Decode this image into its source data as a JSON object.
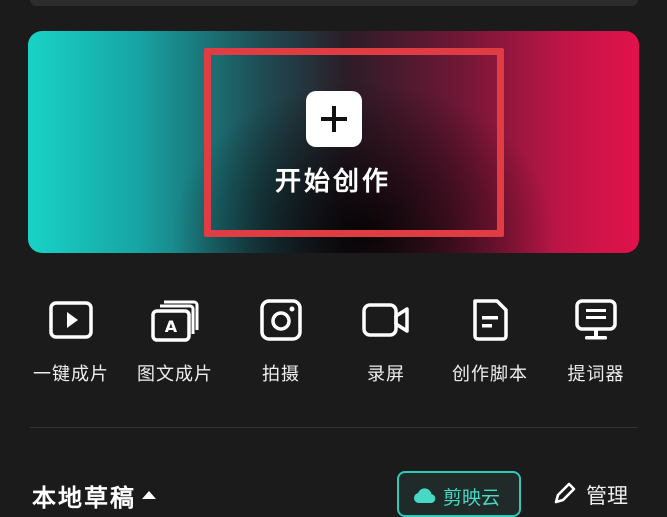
{
  "banner": {
    "create_label": "开始创作",
    "icon": "plus-icon",
    "highlight_color": "#e03c43"
  },
  "tools": [
    {
      "label": "一键成片",
      "icon": "play-video-icon"
    },
    {
      "label": "图文成片",
      "icon": "text-image-icon"
    },
    {
      "label": "拍摄",
      "icon": "camera-icon"
    },
    {
      "label": "录屏",
      "icon": "screen-record-icon"
    },
    {
      "label": "创作脚本",
      "icon": "script-document-icon"
    },
    {
      "label": "提词器",
      "icon": "teleprompter-icon"
    }
  ],
  "drafts": {
    "title": "本地草稿",
    "cloud_label": "剪映云",
    "manage_label": "管理"
  },
  "colors": {
    "background": "#1b1b1b",
    "accent_teal": "#2ec9b8",
    "gradient_left": "#18d3c6",
    "gradient_right": "#e2124b"
  }
}
